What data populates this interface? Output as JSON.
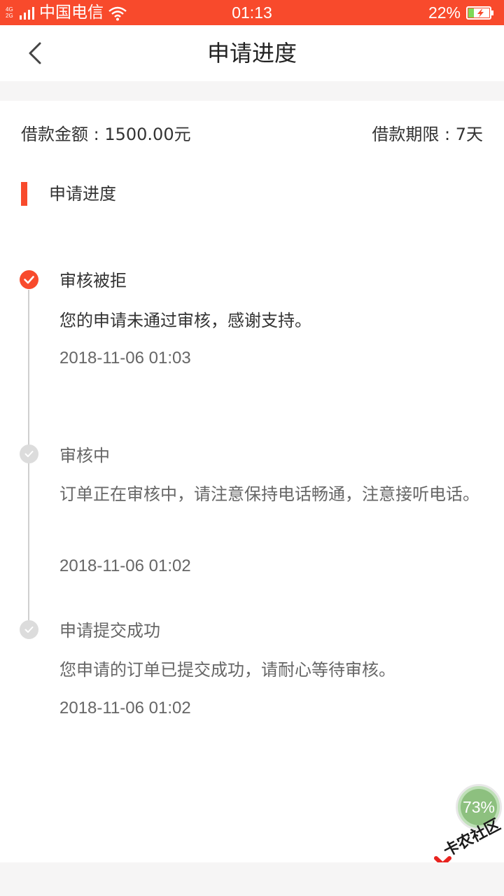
{
  "status_bar": {
    "network_top": "4G",
    "network_bottom": "2G",
    "carrier": "中国电信",
    "time": "01:13",
    "battery_percent": "22%",
    "background_color": "#f84a2c"
  },
  "header": {
    "back_icon": "chevron-left-icon",
    "title": "申请进度"
  },
  "loan": {
    "amount_label": "借款金额 : 1500.00元",
    "term_label": "借款期限 : 7天"
  },
  "section": {
    "title": "申请进度",
    "accent_color": "#f84a2c"
  },
  "steps": [
    {
      "title": "审核被拒",
      "description": "您的申请未通过审核，感谢支持。",
      "time": "2018-11-06 01:03",
      "status": "active",
      "icon": "check-icon"
    },
    {
      "title": "审核中",
      "description": "订单正在审核中，请注意保持电话畅通，注意接听电话。",
      "time": "2018-11-06 01:02",
      "status": "inactive",
      "icon": "check-icon"
    },
    {
      "title": "申请提交成功",
      "description": "您申请的订单已提交成功，请耐心等待审核。",
      "time": "2018-11-06 01:02",
      "status": "inactive",
      "icon": "check-icon"
    }
  ],
  "overlay": {
    "progress_badge": "73%",
    "watermark": "卡农社区"
  }
}
